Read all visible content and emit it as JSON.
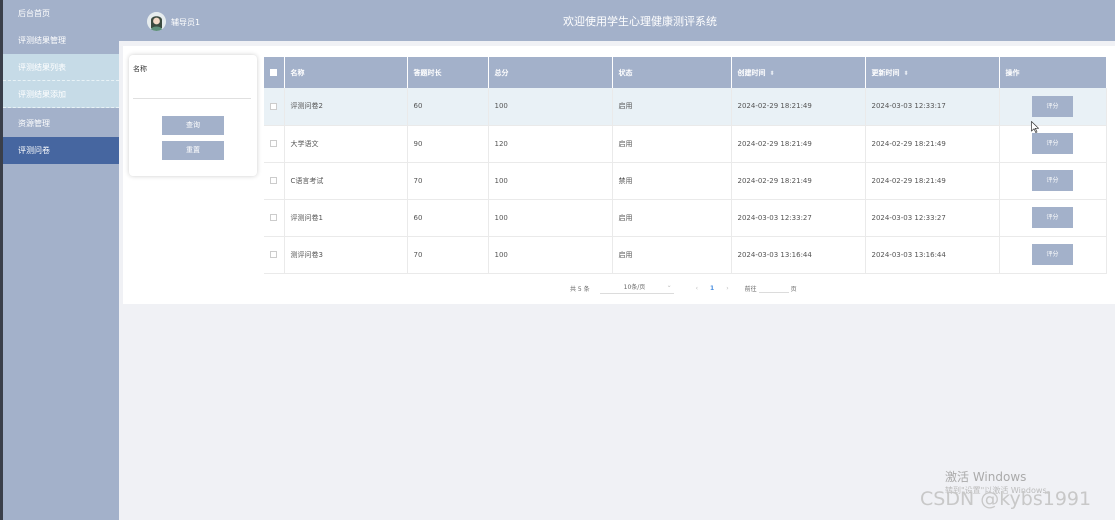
{
  "sidebar": {
    "items": [
      {
        "label": "后台首页"
      },
      {
        "label": "评测结果管理"
      },
      {
        "label": "评测结果列表"
      },
      {
        "label": "评测结果添加"
      },
      {
        "label": "资源管理"
      },
      {
        "label": "评测问卷"
      }
    ]
  },
  "header": {
    "user": "辅导员1",
    "title": "欢迎使用学生心理健康测评系统"
  },
  "search": {
    "label": "名称",
    "placeholder": "",
    "query_label": "查询",
    "reset_label": "重置"
  },
  "table": {
    "headers": [
      "名称",
      "答题时长",
      "总分",
      "状态",
      "创建时间",
      "更新时间",
      "操作"
    ],
    "rows": [
      {
        "name": "评测问卷2",
        "duration": "60",
        "score": "100",
        "status": "启用",
        "created": "2024-02-29 18:21:49",
        "updated": "2024-03-03 12:33:17",
        "action": "评分"
      },
      {
        "name": "大学语文",
        "duration": "90",
        "score": "120",
        "status": "启用",
        "created": "2024-02-29 18:21:49",
        "updated": "2024-02-29 18:21:49",
        "action": "评分"
      },
      {
        "name": "C语言考试",
        "duration": "70",
        "score": "100",
        "status": "禁用",
        "created": "2024-02-29 18:21:49",
        "updated": "2024-02-29 18:21:49",
        "action": "评分"
      },
      {
        "name": "评测问卷1",
        "duration": "60",
        "score": "100",
        "status": "启用",
        "created": "2024-03-03 12:33:27",
        "updated": "2024-03-03 12:33:27",
        "action": "评分"
      },
      {
        "name": "测评问卷3",
        "duration": "70",
        "score": "100",
        "status": "启用",
        "created": "2024-03-03 13:16:44",
        "updated": "2024-03-03 13:16:44",
        "action": "评分"
      }
    ]
  },
  "pager": {
    "total": "共 5 条",
    "size": "10条/页",
    "current": "1",
    "goto_prefix": "前往",
    "goto_suffix": "页"
  },
  "watermark": {
    "activate_title": "激活 Windows",
    "activate_sub": "转到\"设置\"以激活 Windows。",
    "csdn": "CSDN @kybs1991"
  },
  "colors": {
    "primary": "#a3b1ca",
    "active": "#4666a0",
    "submenu": "#c6dbe7",
    "pager_active": "#4a8fe0"
  }
}
